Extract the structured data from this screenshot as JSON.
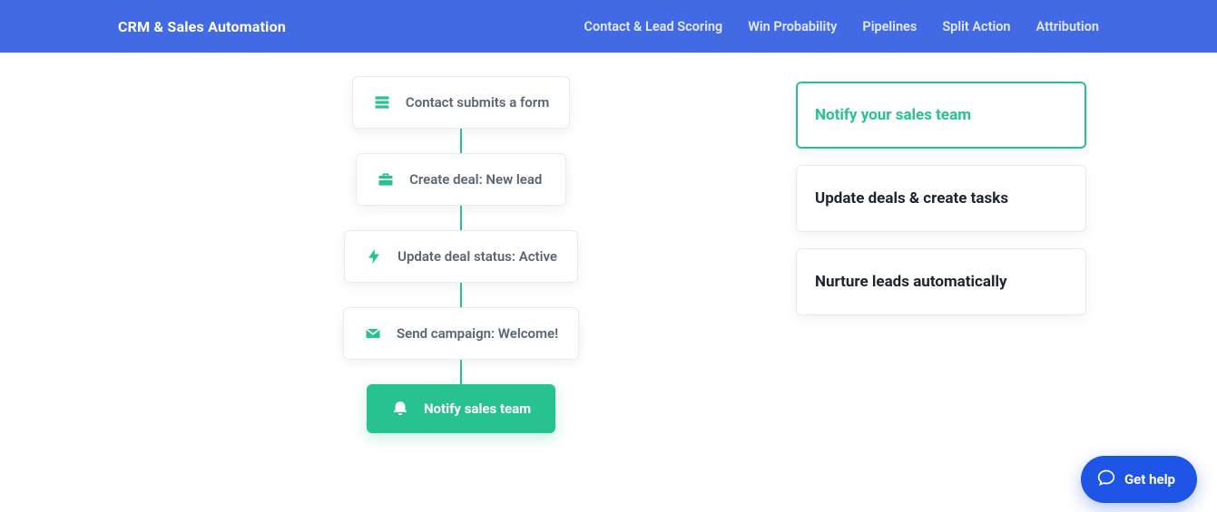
{
  "colors": {
    "primary": "#426ae5",
    "accent": "#27c28f"
  },
  "header": {
    "brand": "CRM & Sales Automation",
    "nav": {
      "contact_lead_scoring": "Contact & Lead Scoring",
      "win_probability": "Win Probability",
      "pipelines": "Pipelines",
      "split_action": "Split Action",
      "attribution": "Attribution"
    }
  },
  "flow": {
    "steps": {
      "submit_form": {
        "icon": "form-icon",
        "label": "Contact submits a form"
      },
      "create_deal": {
        "icon": "briefcase-icon",
        "label": "Create deal: New lead"
      },
      "update_status": {
        "icon": "bolt-icon",
        "label": "Update deal status: Active"
      },
      "send_campaign": {
        "icon": "mail-icon",
        "label": "Send campaign: Welcome!"
      },
      "notify_team": {
        "icon": "bell-icon",
        "label": "Notify sales team"
      }
    }
  },
  "side": {
    "card_notify": "Notify your sales team",
    "card_update": "Update deals & create tasks",
    "card_nurture": "Nurture leads automatically"
  },
  "help": {
    "label": "Get help"
  }
}
